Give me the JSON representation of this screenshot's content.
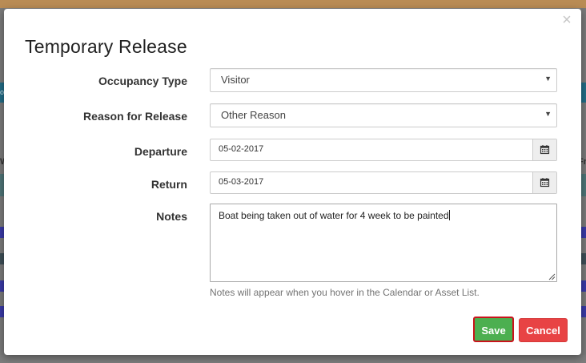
{
  "dialog": {
    "title": "Temporary Release",
    "close_label": "×",
    "occupancy_type": {
      "label": "Occupancy Type",
      "value": "Visitor"
    },
    "reason_for_release": {
      "label": "Reason for Release",
      "value": "Other Reason"
    },
    "departure": {
      "label": "Departure",
      "value": "05-02-2017"
    },
    "return": {
      "label": "Return",
      "value": "05-03-2017"
    },
    "notes": {
      "label": "Notes",
      "value": "Boat being taken out of water for 4 week to be painted",
      "help": "Notes will appear when you hover in the Calendar or Asset List."
    },
    "save_label": "Save",
    "cancel_label": "Cancel"
  },
  "background": {
    "left_glyph_1": "o",
    "left_glyph_2": "W",
    "right_glyph": "Fr"
  },
  "colors": {
    "save": "#4caf50",
    "save_highlight": "#c9131c",
    "cancel": "#e84344"
  }
}
